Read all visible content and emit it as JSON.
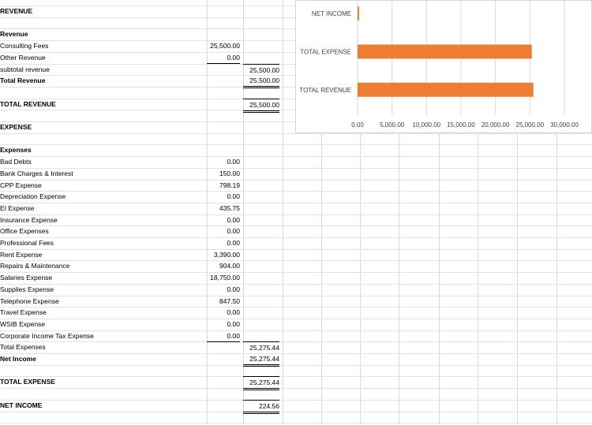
{
  "sheet": {
    "rows": [
      {
        "label": "REVENUE",
        "bold": true,
        "c": "",
        "d": ""
      },
      {
        "label": "",
        "bold": false,
        "c": "",
        "d": ""
      },
      {
        "label": "Revenue",
        "bold": true,
        "c": "",
        "d": ""
      },
      {
        "label": "Consulting Fees",
        "bold": false,
        "c": "25,500.00",
        "d": ""
      },
      {
        "label": "Other Revenue",
        "bold": false,
        "c": "0.00",
        "d": ""
      },
      {
        "label": "subtotal revenue",
        "bold": false,
        "c": "",
        "d": "25,500.00"
      },
      {
        "label": "Total Revenue",
        "bold": true,
        "c": "",
        "d": "25,500.00"
      },
      {
        "label": "",
        "bold": false,
        "c": "",
        "d": ""
      },
      {
        "label": "TOTAL REVENUE",
        "bold": true,
        "c": "",
        "d": "25,500.00"
      },
      {
        "label": "",
        "bold": false,
        "c": "",
        "d": ""
      },
      {
        "label": "EXPENSE",
        "bold": true,
        "c": "",
        "d": ""
      },
      {
        "label": "",
        "bold": false,
        "c": "",
        "d": ""
      },
      {
        "label": "Expenses",
        "bold": true,
        "c": "",
        "d": ""
      },
      {
        "label": "Bad Debts",
        "bold": false,
        "c": "0.00",
        "d": ""
      },
      {
        "label": "Bank Charges & Interest",
        "bold": false,
        "c": "150.00",
        "d": ""
      },
      {
        "label": "CPP Expense",
        "bold": false,
        "c": "798.19",
        "d": ""
      },
      {
        "label": "Depreciation Expense",
        "bold": false,
        "c": "0.00",
        "d": ""
      },
      {
        "label": "EI Expense",
        "bold": false,
        "c": "435.75",
        "d": ""
      },
      {
        "label": "Insurance Expense",
        "bold": false,
        "c": "0.00",
        "d": ""
      },
      {
        "label": "Office Expenses",
        "bold": false,
        "c": "0.00",
        "d": ""
      },
      {
        "label": "Professional Fees",
        "bold": false,
        "c": "0.00",
        "d": ""
      },
      {
        "label": "Rent Expense",
        "bold": false,
        "c": "3,390.00",
        "d": ""
      },
      {
        "label": "Repairs & Maintenance",
        "bold": false,
        "c": "904.00",
        "d": ""
      },
      {
        "label": "Salaries Expense",
        "bold": false,
        "c": "18,750.00",
        "d": ""
      },
      {
        "label": "Supplies Expense",
        "bold": false,
        "c": "0.00",
        "d": ""
      },
      {
        "label": "Telephone Expense",
        "bold": false,
        "c": "847.50",
        "d": ""
      },
      {
        "label": "Travel Expense",
        "bold": false,
        "c": "0.00",
        "d": ""
      },
      {
        "label": "WSIB Expense",
        "bold": false,
        "c": "0.00",
        "d": ""
      },
      {
        "label": "Corporate Income Tax Expense",
        "bold": false,
        "c": "0.00",
        "d": ""
      },
      {
        "label": "Total Expenses",
        "bold": false,
        "c": "",
        "d": "25,275.44"
      },
      {
        "label": "Net Income",
        "bold": true,
        "c": "",
        "d": "25,275.44"
      },
      {
        "label": "",
        "bold": false,
        "c": "",
        "d": ""
      },
      {
        "label": "TOTAL EXPENSE",
        "bold": true,
        "c": "",
        "d": "25,275.44"
      },
      {
        "label": "",
        "bold": false,
        "c": "",
        "d": ""
      },
      {
        "label": "NET INCOME",
        "bold": true,
        "c": "",
        "d": "224.56"
      }
    ]
  },
  "chart_data": {
    "type": "bar",
    "orientation": "horizontal",
    "categories": [
      "NET INCOME",
      "TOTAL EXPENSE",
      "TOTAL REVENUE"
    ],
    "values": [
      224.56,
      25275.44,
      25500.0
    ],
    "xlim": [
      0,
      30000
    ],
    "xticks": [
      "0.00",
      "5,000.00",
      "10,000.00",
      "15,000.00",
      "20,000.00",
      "25,000.00",
      "30,000.00"
    ],
    "title": "",
    "xlabel": "",
    "ylabel": "",
    "grid": "vertical",
    "legend": "none",
    "bar_color": "#ED7D31"
  }
}
